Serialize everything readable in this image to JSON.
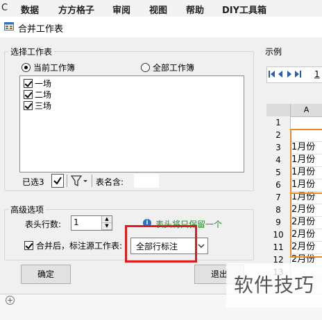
{
  "menu": {
    "items": [
      "C",
      "数据",
      "方方格子",
      "审阅",
      "视图",
      "帮助",
      "DIY工具箱"
    ]
  },
  "dialog": {
    "title": "合并工作表",
    "select_group": {
      "legend": "选择工作表",
      "radio_current": "当前工作簿",
      "radio_all": "全部工作簿",
      "selected_radio": "当前工作簿",
      "sheets": [
        {
          "name": "一场",
          "checked": true
        },
        {
          "name": "二场",
          "checked": true
        },
        {
          "name": "三场",
          "checked": true
        }
      ],
      "selected_count": "已选3",
      "name_match_label": "表名含:",
      "name_match_value": ""
    },
    "advanced_group": {
      "legend": "高级选项",
      "header_rows_label": "表头行数:",
      "header_rows_value": "1",
      "hint_text": "表头将只保留一个",
      "mark_source_label": "合并后，标注源工作表:",
      "mark_source_checked": true,
      "mark_source_value": "全部行标注"
    },
    "ok_label": "确定",
    "exit_label": "退出"
  },
  "preview": {
    "legend": "示例",
    "tab_partial": "1",
    "column": "A",
    "rows": [
      {
        "num": "1",
        "value": ""
      },
      {
        "num": "2",
        "value": ""
      },
      {
        "num": "3",
        "value": "1月份"
      },
      {
        "num": "4",
        "value": "1月份"
      },
      {
        "num": "5",
        "value": "1月份"
      },
      {
        "num": "6",
        "value": "1月份"
      },
      {
        "num": "7",
        "value": "1月份"
      },
      {
        "num": "8",
        "value": "2月份"
      },
      {
        "num": "9",
        "value": "2月份"
      },
      {
        "num": "10",
        "value": "2月份"
      },
      {
        "num": "11",
        "value": "2月份"
      },
      {
        "num": "12",
        "value": "2月份"
      },
      {
        "num": "13",
        "value": ""
      }
    ]
  },
  "watermark": "软件技巧",
  "colors": {
    "highlight": "#e11b1b",
    "group_outline": "#e88a2a",
    "hint": "#1f8a2a"
  }
}
